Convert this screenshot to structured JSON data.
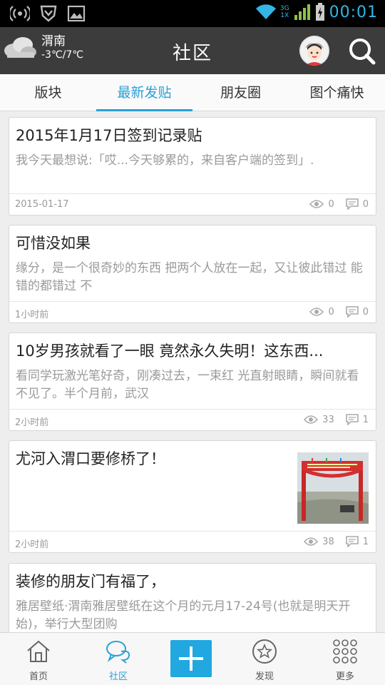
{
  "status_bar": {
    "time": "00:01",
    "network_top": "3G",
    "network_bottom": "1X"
  },
  "header": {
    "city": "渭南",
    "temperature": "-3℃/7℃",
    "title": "社区"
  },
  "tabs": [
    {
      "label": "版块",
      "active": false
    },
    {
      "label": "最新发贴",
      "active": true
    },
    {
      "label": "朋友圈",
      "active": false
    },
    {
      "label": "图个痛快",
      "active": false
    }
  ],
  "posts": [
    {
      "title": "2015年1月17日签到记录贴",
      "excerpt": "我今天最想说:「哎...今天够累的，来自客户端的签到」.",
      "time": "2015-01-17",
      "views": "0",
      "comments": "0"
    },
    {
      "title": "可惜没如果",
      "excerpt": "缘分，是一个很奇妙的东西 把两个人放在一起，又让彼此错过 能错的都错过 不",
      "time": "1小时前",
      "views": "0",
      "comments": "0"
    },
    {
      "title": "10岁男孩就看了一眼 竟然永久失明！这东西...",
      "excerpt": "看同学玩激光笔好奇，刚凑过去，一束红 光直射眼睛，瞬间就看不见了。半个月前，武汉",
      "time": "2小时前",
      "views": "33",
      "comments": "1"
    },
    {
      "title": "尤河入渭口要修桥了！",
      "excerpt": "",
      "time": "2小时前",
      "views": "38",
      "comments": "1",
      "has_image": true
    },
    {
      "title": "装修的朋友门有福了，",
      "excerpt": "雅居壁纸·渭南雅居壁纸在这个月的元月17-24号(也就是明天开始)，举行大型团购",
      "time": "",
      "views": "",
      "comments": ""
    }
  ],
  "bottom_nav": [
    {
      "label": "首页",
      "icon": "home-icon",
      "active": false
    },
    {
      "label": "社区",
      "icon": "chat-icon",
      "active": true
    },
    {
      "label": "",
      "icon": "plus-icon",
      "active": false
    },
    {
      "label": "发现",
      "icon": "star-icon",
      "active": false
    },
    {
      "label": "更多",
      "icon": "grid-icon",
      "active": false
    }
  ],
  "colors": {
    "accent": "#2aa1d6",
    "header_bg": "#3c3c3c",
    "status_blue": "#33b5e5",
    "post_button": "#21a8e0"
  }
}
